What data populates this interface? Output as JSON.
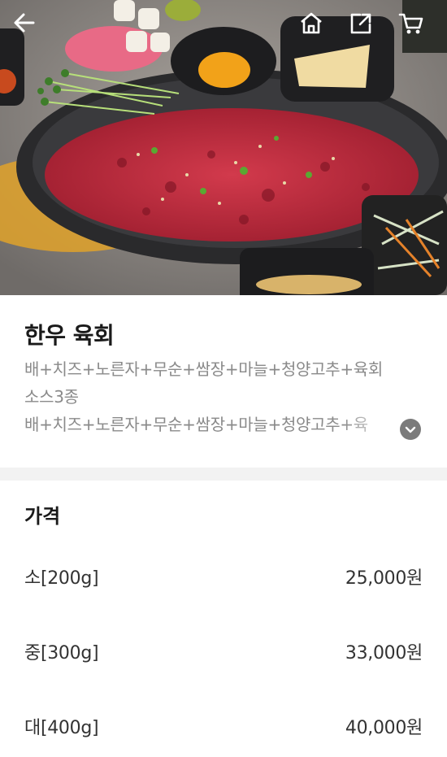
{
  "hero": {
    "image_description_icon": "food-photo-icon"
  },
  "topbar": {
    "back_icon": "arrow-left-icon",
    "home_icon": "home-icon",
    "share_icon": "share-icon",
    "cart_icon": "cart-icon"
  },
  "product": {
    "title": "한우 육회",
    "desc_line1": "배+치즈+노른자+무순+쌈장+마늘+청양고추+육회",
    "desc_line2": "소스3종",
    "desc_line3": "배+치즈+노른자+무순+쌈장+마늘+청양고추+육",
    "expand_icon": "chevron-down-icon"
  },
  "prices": {
    "heading": "가격",
    "items": [
      {
        "name": "소[200g]",
        "price": "25,000원"
      },
      {
        "name": "중[300g]",
        "price": "33,000원"
      },
      {
        "name": "대[400g]",
        "price": "40,000원"
      }
    ]
  }
}
